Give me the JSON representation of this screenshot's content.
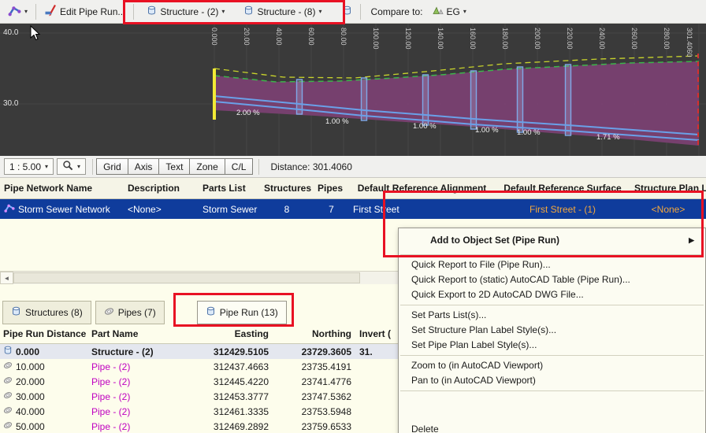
{
  "colors": {
    "annotation_red": "#e81123",
    "selection_blue": "#0f3c9c",
    "pipe_text_magenta": "#c000c0",
    "surface_band_purple": "#7c4173",
    "profile_background": "#3a3a3a",
    "ground_line_green": "#3cb44a",
    "offset_line_yellow": "#c9d42c",
    "pipe_line_blue": "#6aa0e8",
    "panorama_cream": "#fdfdec",
    "amber_cell_text": "#f2a73d"
  },
  "glyphs": {
    "caret": "▾",
    "submenu_arrow": "▶",
    "scroll_left_arrow": "◄"
  },
  "toolbar": {
    "edit_pipe_run_label": "Edit Pipe Run...",
    "structure_dropdown_1": "Structure - (2)",
    "structure_dropdown_2": "Structure - (8)",
    "compare_to_label": "Compare to:",
    "compare_value": "EG"
  },
  "profile": {
    "elevation_labels": [
      "40.0",
      "30.0"
    ],
    "stations": [
      "0.000",
      "20.00",
      "40.00",
      "60.00",
      "80.00",
      "100.00",
      "120.00",
      "140.00",
      "160.00",
      "180.00",
      "200.00",
      "220.00",
      "240.00",
      "260.00",
      "280.00",
      "301.4060"
    ],
    "slopes": [
      "2.00 %",
      "1.00 %",
      "1.00 %",
      "1.00 %",
      "1.00 %",
      "1.71 %"
    ]
  },
  "profile_toolbar": {
    "scale": "1 : 5.00",
    "toggles": [
      "Grid",
      "Axis",
      "Text",
      "Zone",
      "C/L"
    ],
    "distance": "Distance: 301.4060"
  },
  "network_table": {
    "columns": [
      "Pipe Network Name",
      "Description",
      "Parts List",
      "Structures",
      "Pipes",
      "Default Reference Alignment",
      "Default Reference Surface",
      "Structure Plan L"
    ],
    "row": {
      "name": "Storm Sewer Network",
      "description": "<None>",
      "parts_list": "Storm Sewer",
      "structures": "8",
      "pipes": "7",
      "reference_alignment": "First Street",
      "reference_surface": "First Street - (1)",
      "structure_plan_label": "<None>"
    }
  },
  "tabs": {
    "structures": "Structures (8)",
    "pipes": "Pipes (7)",
    "pipe_run": "Pipe Run (13)"
  },
  "run_table": {
    "columns": [
      "Pipe Run Distance",
      "Part Name",
      "Easting",
      "Northing",
      "Invert ("
    ],
    "rows": [
      {
        "distance": "0.000",
        "part": "Structure - (2)",
        "easting": "312429.5105",
        "northing": "23729.3605",
        "invert": "31."
      },
      {
        "distance": "10.000",
        "part": "Pipe - (2)",
        "easting": "312437.4663",
        "northing": "23735.4191",
        "invert": ""
      },
      {
        "distance": "20.000",
        "part": "Pipe - (2)",
        "easting": "312445.4220",
        "northing": "23741.4776",
        "invert": ""
      },
      {
        "distance": "30.000",
        "part": "Pipe - (2)",
        "easting": "312453.3777",
        "northing": "23747.5362",
        "invert": ""
      },
      {
        "distance": "40.000",
        "part": "Pipe - (2)",
        "easting": "312461.3335",
        "northing": "23753.5948",
        "invert": ""
      },
      {
        "distance": "50.000",
        "part": "Pipe - (2)",
        "easting": "312469.2892",
        "northing": "23759.6533",
        "invert": ""
      }
    ]
  },
  "context_menu": {
    "items": [
      "Add to Object Set (Pipe Run)",
      "Quick Report to File (Pipe Run)...",
      "Quick Report to (static) AutoCAD Table (Pipe Run)...",
      "Quick Export to 2D AutoCAD DWG File...",
      "Set Parts List(s)...",
      "Set Structure Plan Label Style(s)...",
      "Set Pipe Plan Label Style(s)...",
      "Zoom to (in AutoCAD Viewport)",
      "Pan to (in AutoCAD Viewport)",
      "Delete"
    ]
  }
}
